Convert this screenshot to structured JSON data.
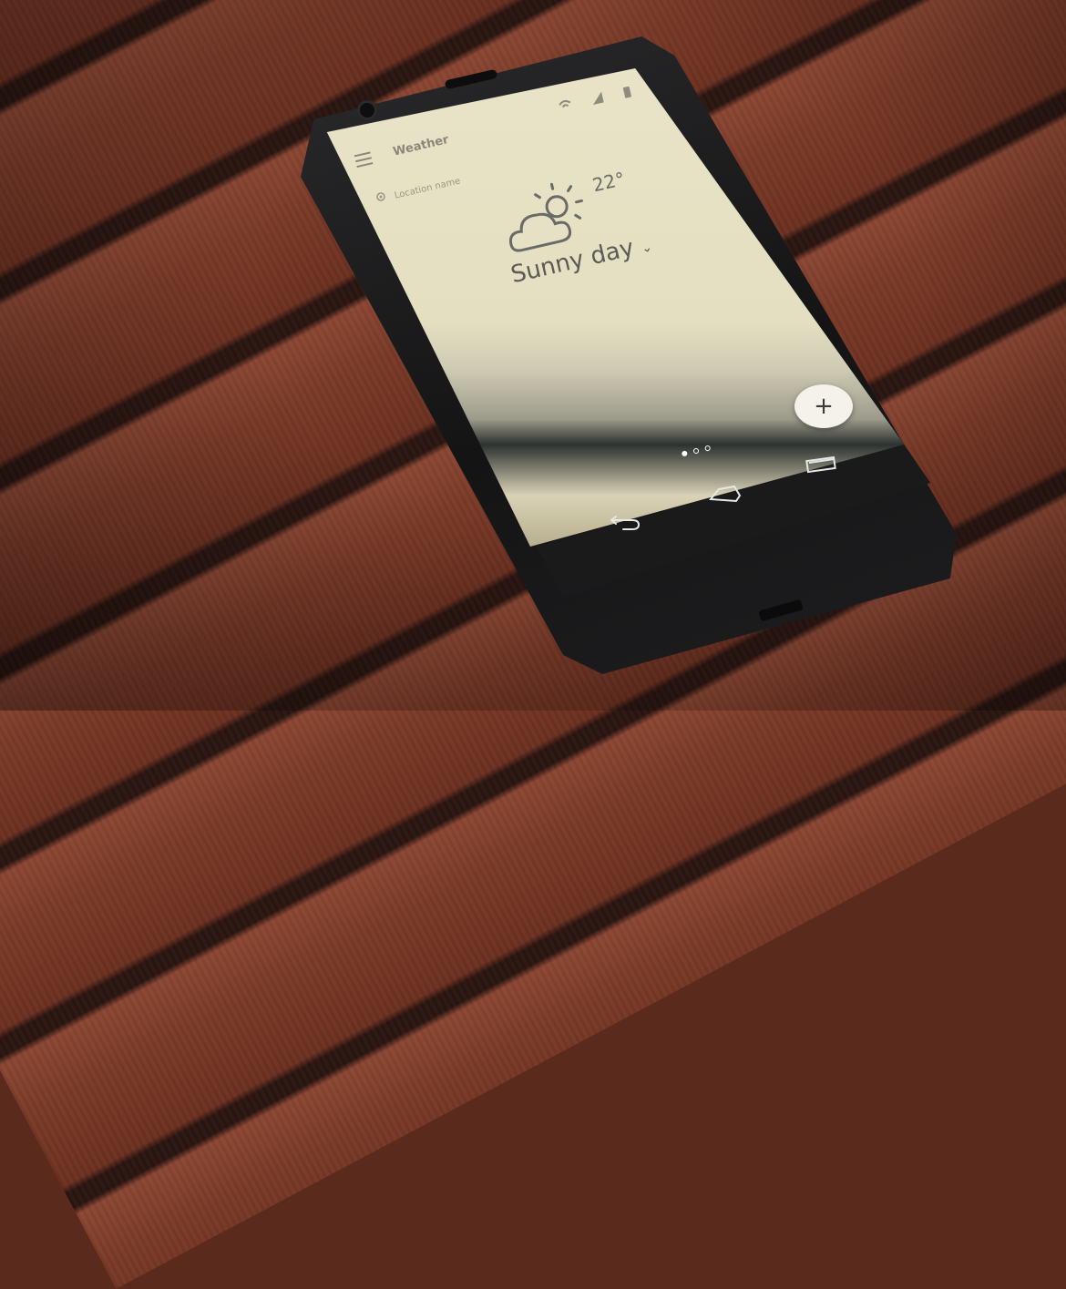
{
  "app": {
    "title": "Weather",
    "location": "Location name"
  },
  "weather": {
    "temperature": "22°",
    "condition": "Sunny day",
    "icon": "cloud-sun-icon"
  },
  "fab": {
    "label": "+"
  },
  "pager": {
    "pages": 3,
    "active_index": 0
  },
  "navbar": {
    "back_icon": "back-icon",
    "home_icon": "home-icon",
    "recents_icon": "recents-icon"
  },
  "colors": {
    "screen_bg": "#e9e4c8",
    "table_wood": "#7a3a28",
    "phone_body": "#1a1a1b",
    "fab_bg": "#f4f2ea"
  }
}
